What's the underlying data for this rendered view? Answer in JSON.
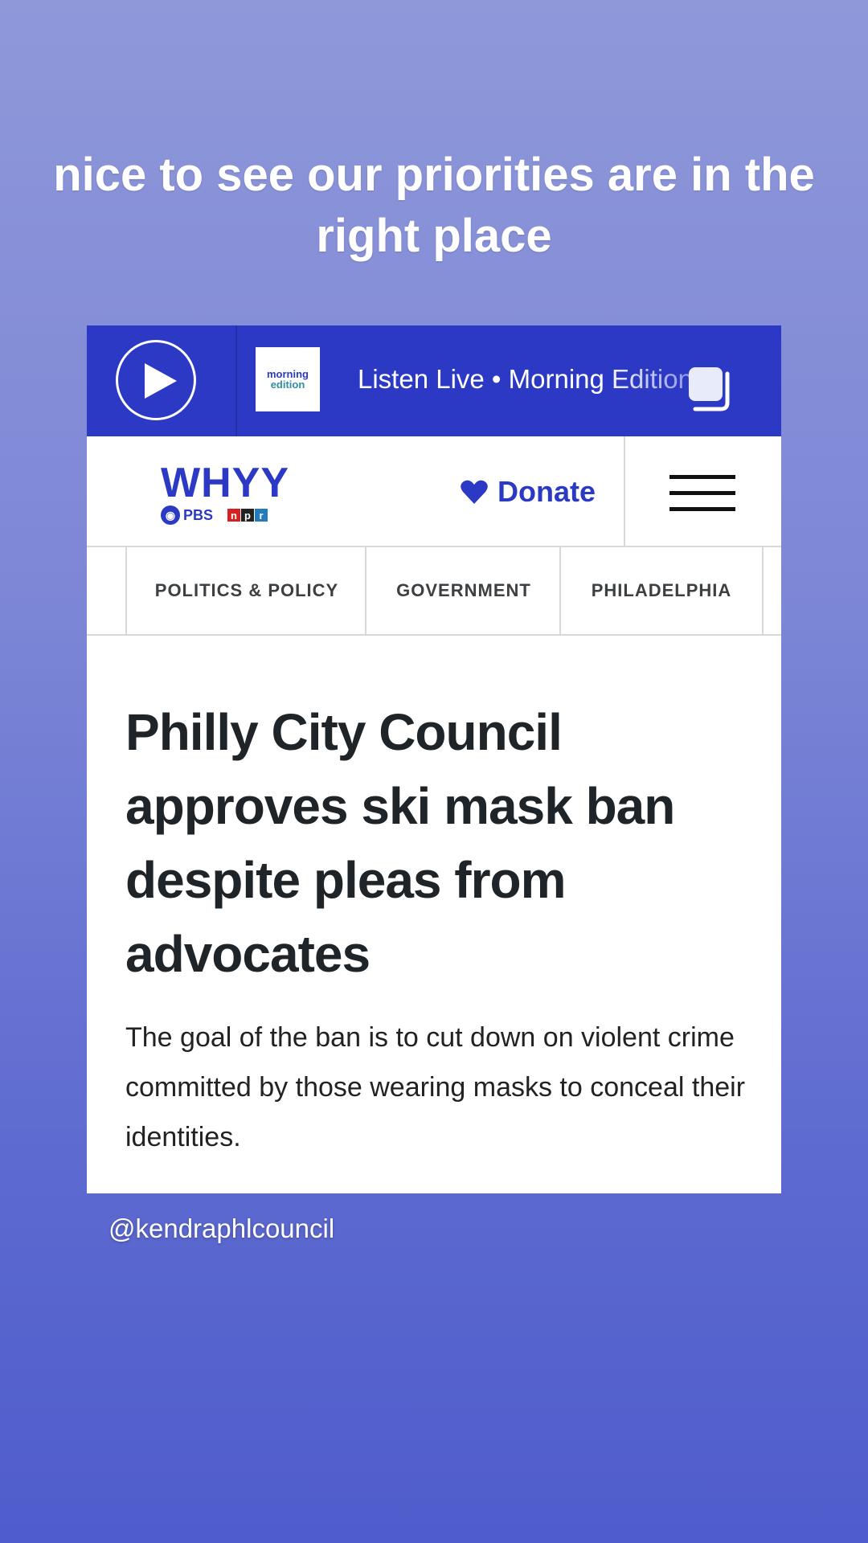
{
  "story": {
    "caption": "nice to see our priorities are in the right place",
    "handle": "@kendraphlcouncil"
  },
  "player": {
    "show_logo_line1": "morning",
    "show_logo_line2": "edition",
    "listen_text": "Listen Live • Morning Edition"
  },
  "masthead": {
    "brand": "WHYY",
    "pbs": "PBS",
    "npr": [
      "n",
      "p",
      "r"
    ],
    "donate_label": "Donate"
  },
  "tags": [
    "POLITICS & POLICY",
    "GOVERNMENT",
    "PHILADELPHIA"
  ],
  "article": {
    "headline": "Philly City Council approves ski mask ban despite pleas from advocates",
    "dek": "The goal of the ban is to cut down on violent crime committed by those wearing masks to conceal their identities."
  },
  "colors": {
    "brand_blue": "#2b39c4",
    "npr_red": "#d62021",
    "npr_black": "#222222",
    "npr_blue": "#237bbd"
  }
}
